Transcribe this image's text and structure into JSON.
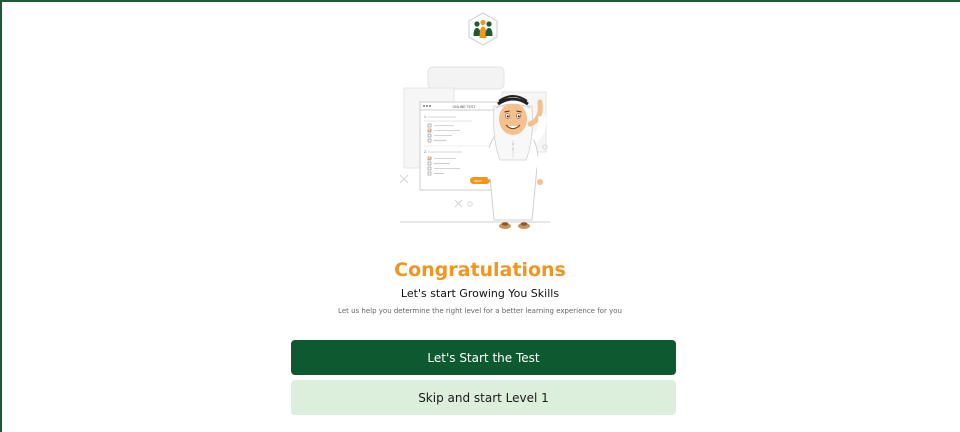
{
  "content": {
    "title": "Congratulations",
    "subtitle": "Let's start Growing You Skills",
    "description": "Let us help you determine the right level for a better learning experience for you"
  },
  "illustration": {
    "test_header": "ONLINE TEST",
    "next_label": "NEXT"
  },
  "actions": {
    "start_test_label": "Let's Start the Test",
    "skip_label": "Skip and start Level 1"
  },
  "colors": {
    "brand_green": "#0e5a30",
    "accent_orange": "#f0951e",
    "light_green": "#dcefdc"
  }
}
